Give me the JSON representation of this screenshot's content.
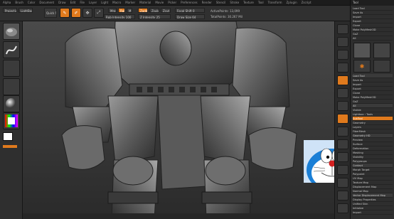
{
  "menubar": {
    "items": [
      "Alpha",
      "Brush",
      "Color",
      "Document",
      "Draw",
      "Edit",
      "File",
      "Layer",
      "Light",
      "Macro",
      "Marker",
      "Material",
      "Movie",
      "Picker",
      "Preferences",
      "Render",
      "Stencil",
      "Stroke",
      "Texture",
      "Tool",
      "Transform",
      "Zplugin",
      "Zscript"
    ]
  },
  "shelf": {
    "projection": "Projection Master",
    "lightbox": "LightBox",
    "quicksketch": "Quick Sketch",
    "mrgb": "Mrgb",
    "rgb": "Rgb",
    "m": "M",
    "zadd": "Zadd",
    "zsub": "Zsub",
    "zcut": "Zcut",
    "focal_shift": "Focal Shift 0",
    "draw_size": "Draw Size 64",
    "rgb_intensity": "Rgb Intensity 100",
    "z_intensity": "Z Intensity 25",
    "active_points": "ActivePoints: 13,099",
    "total_points": "TotalPoints: 30.267 Mil"
  },
  "tray": {
    "title": "Tool",
    "rows": [
      "Load Tool",
      "Save As",
      "Import",
      "Export",
      "Clone",
      "Make PolyMesh3D",
      "GoZ",
      "All",
      "Visible",
      "Lightbox › Tools",
      "SubTool",
      "Geometry",
      "Layers",
      "FiberMesh",
      "Geometry HD",
      "Preview",
      "Surface",
      "Deformation",
      "Masking",
      "Visibility",
      "Polygroups",
      "Contact",
      "Morph Target",
      "Polypaint",
      "UV Map",
      "Texture Map",
      "Displacement Map",
      "Normal Map",
      "Vector Displacement Map",
      "Display Properties",
      "Unified Skin",
      "Initialize",
      "Import",
      "Export"
    ]
  },
  "bottom": {
    "status": ""
  },
  "colors": {
    "accent": "#e07a1d",
    "panel": "#2e2e2e",
    "canvas": "#363636"
  },
  "overlay": {
    "subject": "Doraemon face",
    "icon": "doraemon-thumbnail"
  }
}
